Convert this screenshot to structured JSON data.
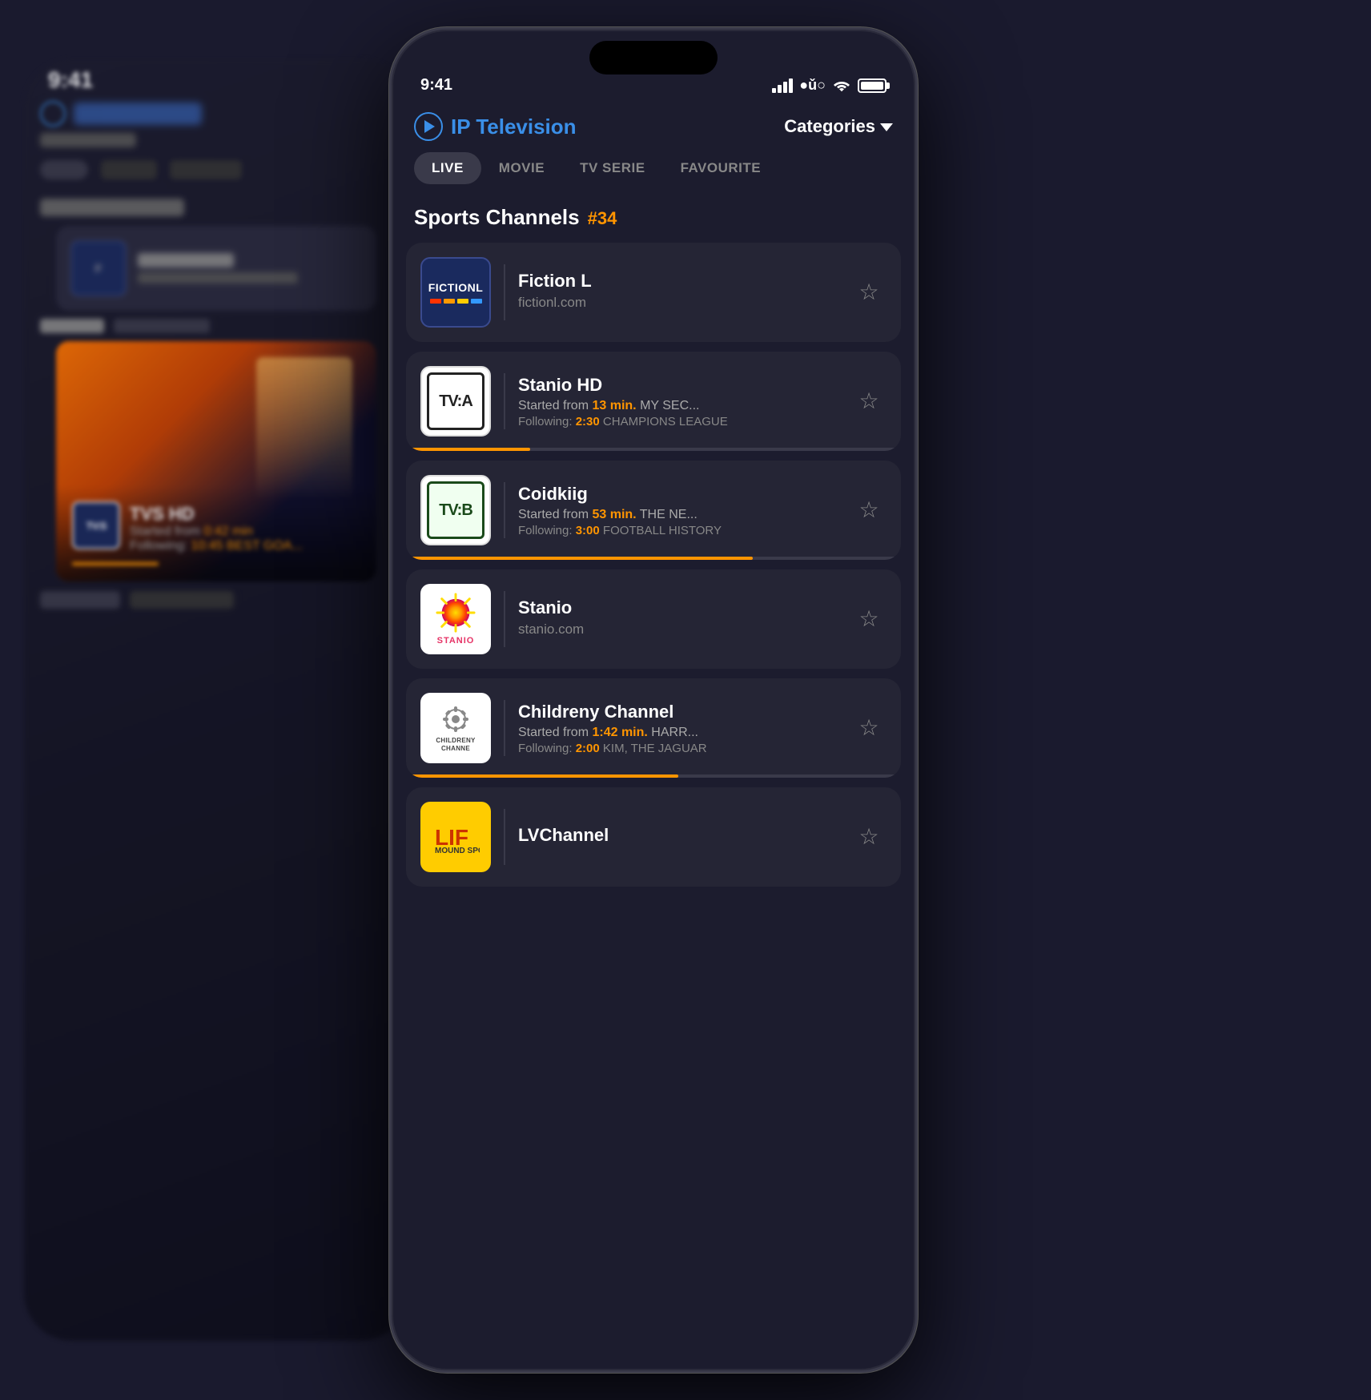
{
  "app": {
    "title": "IP Television",
    "play_icon": "play-icon",
    "categories_label": "Categories"
  },
  "status_bar": {
    "time": "9:41",
    "bg_time": "9:41"
  },
  "tabs": [
    {
      "id": "live",
      "label": "LIVE",
      "active": true
    },
    {
      "id": "movie",
      "label": "MOVIE",
      "active": false
    },
    {
      "id": "tv-serie",
      "label": "TV SERIE",
      "active": false
    },
    {
      "id": "favourite",
      "label": "FAVOURITE",
      "active": false
    }
  ],
  "section": {
    "title": "Sports Channels",
    "count": "#34"
  },
  "channels": [
    {
      "id": "fiction-l",
      "name": "Fiction L",
      "subtitle": "fictionl.com",
      "has_timing": false,
      "progress": 0,
      "logo_type": "fictionl"
    },
    {
      "id": "stanio-hd",
      "name": "Stanio HD",
      "timing_label": "Started from",
      "timing_value": "13 min.",
      "timing_rest": "MY SEC...",
      "following_label": "Following:",
      "following_time": "2:30",
      "following_rest": "CHAMPIONS LEAGUE",
      "progress": 25,
      "logo_type": "tva"
    },
    {
      "id": "coidkiig",
      "name": "Coidkiig",
      "timing_label": "Started from",
      "timing_value": "53 min.",
      "timing_rest": "THE NE...",
      "following_label": "Following:",
      "following_time": "3:00",
      "following_rest": "FOOTBALL HISTORY",
      "progress": 70,
      "logo_type": "tvb"
    },
    {
      "id": "stanio",
      "name": "Stanio",
      "subtitle": "stanio.com",
      "has_timing": false,
      "progress": 0,
      "logo_type": "stanio"
    },
    {
      "id": "childreny",
      "name": "Childreny Channel",
      "timing_label": "Started from",
      "timing_value": "1:42 min.",
      "timing_rest": "HARR...",
      "following_label": "Following:",
      "following_time": "2:00",
      "following_rest": "KIM, THE JAGUAR",
      "progress": 55,
      "logo_type": "childreny"
    },
    {
      "id": "lvchannel",
      "name": "LVChannel",
      "has_timing": false,
      "progress": 0,
      "logo_type": "lvchannel"
    }
  ],
  "bg_phone": {
    "time": "9:41",
    "hero_title": "TVS HD",
    "hero_timing": "0:42 min",
    "hero_following": "10:45 BEST GOA..."
  }
}
